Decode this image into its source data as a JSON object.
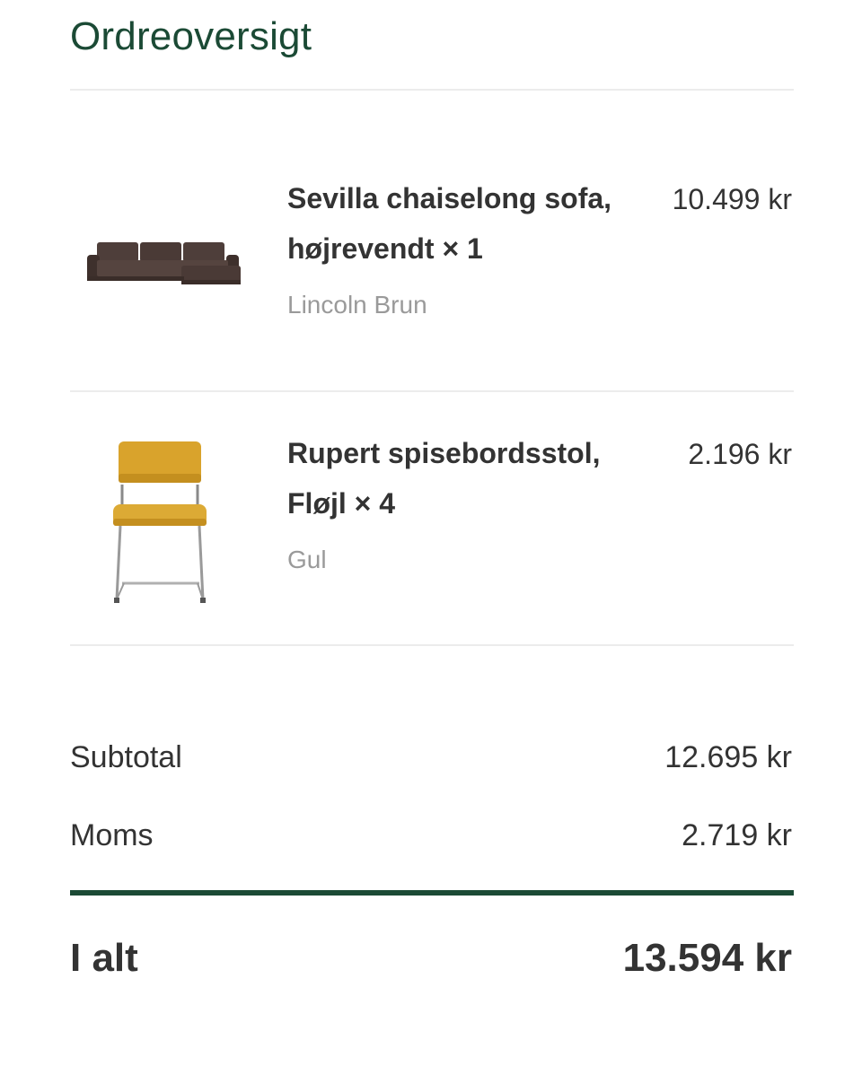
{
  "header": {
    "title": "Ordreoversigt"
  },
  "items": [
    {
      "name": "Sevilla chaiselong sofa, højrevendt × 1",
      "variant": "Lincoln Brun",
      "price": "10.499 kr",
      "image_icon": "sofa-image"
    },
    {
      "name": "Rupert spisebordsstol, Fløjl × 4",
      "variant": "Gul",
      "price": "2.196 kr",
      "image_icon": "chair-image"
    }
  ],
  "summary": {
    "subtotal_label": "Subtotal",
    "subtotal_value": "12.695 kr",
    "vat_label": "Moms",
    "vat_value": "2.719 kr",
    "total_label": "I alt",
    "total_value": "13.594 kr"
  },
  "colors": {
    "accent": "#1b4a35",
    "text": "#333333",
    "muted": "#9a9a9a",
    "sofa": "#4a3a36",
    "chair_seat": "#d9a32c"
  }
}
